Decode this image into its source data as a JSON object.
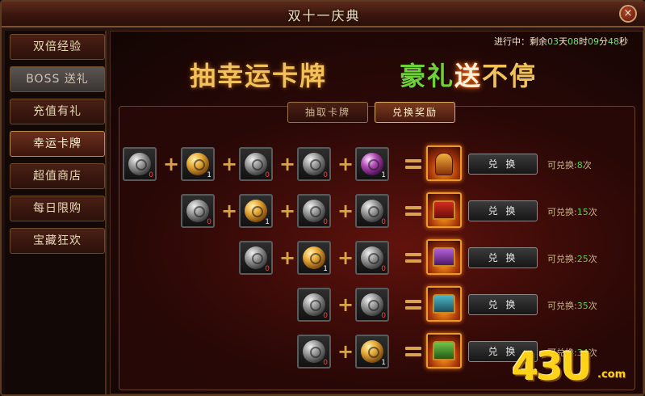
{
  "window": {
    "title": "双十一庆典",
    "close_icon": "×"
  },
  "sidebar": {
    "items": [
      {
        "label": "双倍经验",
        "state": "normal"
      },
      {
        "label": "BOSS 送礼",
        "state": "dim"
      },
      {
        "label": "充值有礼",
        "state": "normal"
      },
      {
        "label": "幸运卡牌",
        "state": "active"
      },
      {
        "label": "超值商店",
        "state": "normal"
      },
      {
        "label": "每日限购",
        "state": "normal"
      },
      {
        "label": "宝藏狂欢",
        "state": "normal"
      }
    ]
  },
  "timer": {
    "prefix": "进行中：剩余",
    "days": "03",
    "d_unit": "天",
    "hours": "08",
    "h_unit": "时",
    "minutes": "09",
    "m_unit": "分",
    "seconds": "48",
    "s_unit": "秒"
  },
  "banner": {
    "left": "抽幸运卡牌",
    "right_a": "豪礼",
    "right_b": "送",
    "right_c": "不停"
  },
  "tabs": {
    "draw": "抽取卡牌",
    "exchange": "兑换奖励",
    "active": "exchange"
  },
  "exchange_button_label": "兑 换",
  "avail_prefix": "可兑换:",
  "avail_suffix": "次",
  "rows": [
    {
      "cards": [
        {
          "type": "silver",
          "count": "0"
        },
        {
          "type": "gold",
          "count": "1"
        },
        {
          "type": "silver",
          "count": "0"
        },
        {
          "type": "silver",
          "count": "0"
        },
        {
          "type": "purple",
          "count": "1"
        }
      ],
      "reward": "helmet",
      "available": "8"
    },
    {
      "cards": [
        {
          "type": "silver",
          "count": "0"
        },
        {
          "type": "gold",
          "count": "1"
        },
        {
          "type": "silver",
          "count": "0"
        },
        {
          "type": "silver",
          "count": "0"
        }
      ],
      "reward": "red-chest",
      "available": "15"
    },
    {
      "cards": [
        {
          "type": "silver",
          "count": "0"
        },
        {
          "type": "gold",
          "count": "1"
        },
        {
          "type": "silver",
          "count": "0"
        }
      ],
      "reward": "purple-chest",
      "available": "25"
    },
    {
      "cards": [
        {
          "type": "silver",
          "count": "0"
        },
        {
          "type": "silver",
          "count": "0"
        }
      ],
      "reward": "cyan-chest",
      "available": "35"
    },
    {
      "cards": [
        {
          "type": "silver",
          "count": "0"
        },
        {
          "type": "gold",
          "count": "1"
        }
      ],
      "reward": "green-chest",
      "available": "34"
    }
  ],
  "watermark": {
    "logo": "43U",
    "domain": ".com"
  }
}
